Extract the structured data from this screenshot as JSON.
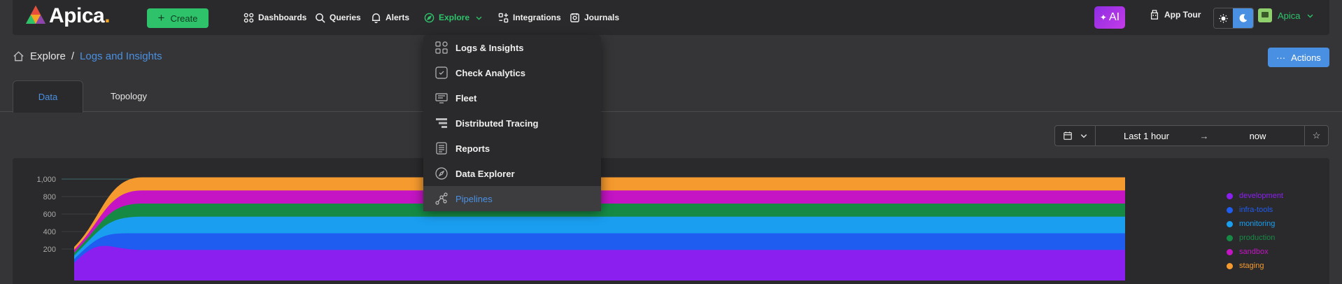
{
  "app": {
    "logo_text": "Apica",
    "create_label": "Create"
  },
  "nav": {
    "items": [
      {
        "label": "Dashboards",
        "icon": "grid-icon"
      },
      {
        "label": "Queries",
        "icon": "search-icon"
      },
      {
        "label": "Alerts",
        "icon": "bell-icon"
      },
      {
        "label": "Explore",
        "icon": "compass-icon",
        "active": true
      },
      {
        "label": "Integrations",
        "icon": "integrations-icon"
      },
      {
        "label": "Journals",
        "icon": "journal-icon"
      }
    ],
    "ai_label": "AI",
    "app_tour_label": "App Tour",
    "user_name": "Apica"
  },
  "breadcrumb": {
    "root": "Explore",
    "separator": "/",
    "current": "Logs and Insights"
  },
  "actions_label": "Actions",
  "tabs": [
    {
      "label": "Data",
      "active": true
    },
    {
      "label": "Topology",
      "active": false
    }
  ],
  "timerange": {
    "from": "Last 1 hour",
    "to": "now"
  },
  "explore_menu": [
    {
      "label": "Logs & Insights",
      "icon": "logs-insights-icon"
    },
    {
      "label": "Check Analytics",
      "icon": "check-analytics-icon"
    },
    {
      "label": "Fleet",
      "icon": "fleet-icon"
    },
    {
      "label": "Distributed Tracing",
      "icon": "tracing-icon"
    },
    {
      "label": "Reports",
      "icon": "reports-icon"
    },
    {
      "label": "Data Explorer",
      "icon": "data-explorer-icon"
    },
    {
      "label": "Pipelines",
      "icon": "pipelines-icon",
      "selected": true
    }
  ],
  "colors": {
    "accent_green": "#2ec36b",
    "accent_blue": "#4a90e2"
  },
  "chart_data": {
    "type": "area",
    "stacked": true,
    "yticks": [
      "1,000",
      "800",
      "600",
      "400",
      "200"
    ],
    "ylim": [
      0,
      1000
    ],
    "series": [
      {
        "name": "development",
        "color": "#8a1ff0",
        "plateau": 190
      },
      {
        "name": "infra-tools",
        "color": "#1f5cf0",
        "plateau": 190
      },
      {
        "name": "monitoring",
        "color": "#1a9ef0",
        "plateau": 190
      },
      {
        "name": "production",
        "color": "#168a45",
        "plateau": 150
      },
      {
        "name": "sandbox",
        "color": "#c414c4",
        "plateau": 150
      },
      {
        "name": "staging",
        "color": "#f59a2e",
        "plateau": 150
      }
    ]
  }
}
